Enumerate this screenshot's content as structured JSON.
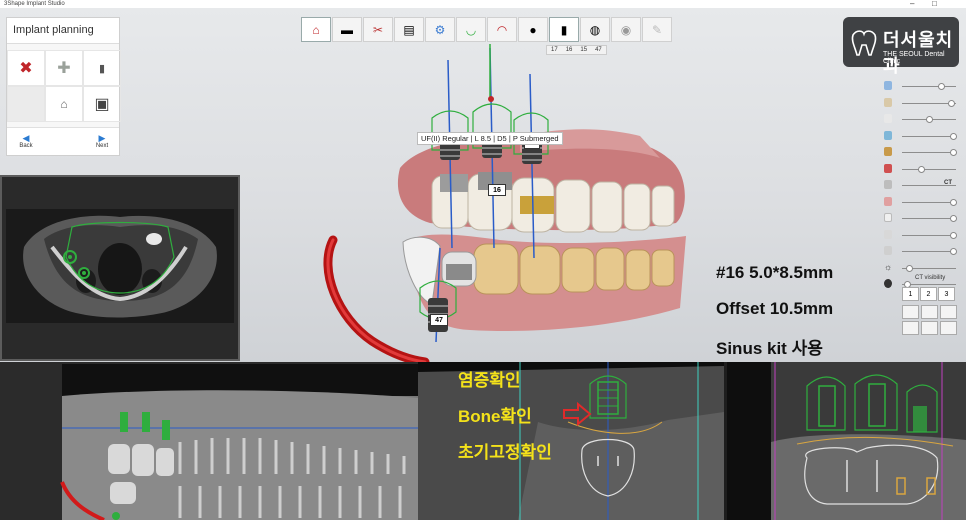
{
  "app_title": "3Shape Implant Studio",
  "window_controls": {
    "minimize": "–",
    "maximize": "□"
  },
  "panel": {
    "title": "Implant planning",
    "tools": [
      {
        "icon": "delete-x-icon",
        "glyph": "✖",
        "color": "#c0262a"
      },
      {
        "icon": "add-plus-icon",
        "glyph": "✚",
        "color": "#9aa19a"
      },
      {
        "icon": "implant-icon",
        "glyph": "▮",
        "color": "#555555"
      },
      {
        "icon": "empty-slot",
        "glyph": "",
        "color": "#cccccc"
      },
      {
        "icon": "abutment-icon",
        "glyph": "⌂",
        "color": "#666666"
      },
      {
        "icon": "sleeve-icon",
        "glyph": "▣",
        "color": "#444444"
      }
    ],
    "back_label": "Back",
    "next_label": "Next"
  },
  "toolbar": {
    "buttons": [
      "home-icon",
      "scan-icon",
      "tools-icon",
      "doc-icon",
      "implant-plan-icon",
      "arch-icon",
      "crown-icon",
      "tooth-icon",
      "implant-icon",
      "guide-icon",
      "disc-icon",
      "wrench-icon"
    ],
    "teeth": [
      "17",
      "16",
      "15",
      "47"
    ]
  },
  "logo": {
    "ko": "더서울치과",
    "en": "THE SEOUL Dental Clinic"
  },
  "slider_ct_label": "CT",
  "ct_visibility_label": "CT visibility",
  "ct_buttons": [
    "1",
    "2",
    "3"
  ],
  "tooltip": "UF(II) Regular | L 8.5 | D5 | P Submerged",
  "implant_labels": {
    "upper_mid": "16",
    "upper_right": "15",
    "lower": "47"
  },
  "notes": {
    "line1": "#16 5.0*8.5mm",
    "line2": "Offset 10.5mm",
    "line3": "Sinus kit 사용"
  },
  "checks": {
    "line1": "염증확인",
    "line2": "Bone확인",
    "line3": "초기고정확인"
  },
  "colors": {
    "implant_green": "#2fae3e",
    "axis_blue": "#2a5cc8",
    "note_yellow": "#f4e21a",
    "arrow_red": "#e02a2a",
    "nerve_red": "#d21a1a"
  }
}
